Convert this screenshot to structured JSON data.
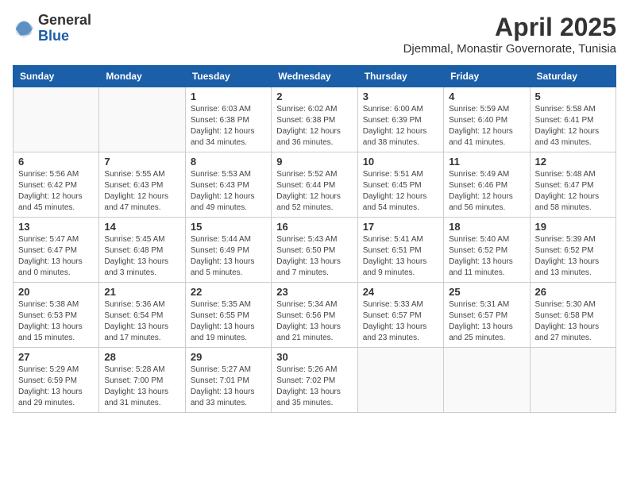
{
  "header": {
    "logo_general": "General",
    "logo_blue": "Blue",
    "month_title": "April 2025",
    "subtitle": "Djemmal, Monastir Governorate, Tunisia"
  },
  "weekdays": [
    "Sunday",
    "Monday",
    "Tuesday",
    "Wednesday",
    "Thursday",
    "Friday",
    "Saturday"
  ],
  "weeks": [
    [
      {
        "day": "",
        "info": ""
      },
      {
        "day": "",
        "info": ""
      },
      {
        "day": "1",
        "info": "Sunrise: 6:03 AM\nSunset: 6:38 PM\nDaylight: 12 hours and 34 minutes."
      },
      {
        "day": "2",
        "info": "Sunrise: 6:02 AM\nSunset: 6:38 PM\nDaylight: 12 hours and 36 minutes."
      },
      {
        "day": "3",
        "info": "Sunrise: 6:00 AM\nSunset: 6:39 PM\nDaylight: 12 hours and 38 minutes."
      },
      {
        "day": "4",
        "info": "Sunrise: 5:59 AM\nSunset: 6:40 PM\nDaylight: 12 hours and 41 minutes."
      },
      {
        "day": "5",
        "info": "Sunrise: 5:58 AM\nSunset: 6:41 PM\nDaylight: 12 hours and 43 minutes."
      }
    ],
    [
      {
        "day": "6",
        "info": "Sunrise: 5:56 AM\nSunset: 6:42 PM\nDaylight: 12 hours and 45 minutes."
      },
      {
        "day": "7",
        "info": "Sunrise: 5:55 AM\nSunset: 6:43 PM\nDaylight: 12 hours and 47 minutes."
      },
      {
        "day": "8",
        "info": "Sunrise: 5:53 AM\nSunset: 6:43 PM\nDaylight: 12 hours and 49 minutes."
      },
      {
        "day": "9",
        "info": "Sunrise: 5:52 AM\nSunset: 6:44 PM\nDaylight: 12 hours and 52 minutes."
      },
      {
        "day": "10",
        "info": "Sunrise: 5:51 AM\nSunset: 6:45 PM\nDaylight: 12 hours and 54 minutes."
      },
      {
        "day": "11",
        "info": "Sunrise: 5:49 AM\nSunset: 6:46 PM\nDaylight: 12 hours and 56 minutes."
      },
      {
        "day": "12",
        "info": "Sunrise: 5:48 AM\nSunset: 6:47 PM\nDaylight: 12 hours and 58 minutes."
      }
    ],
    [
      {
        "day": "13",
        "info": "Sunrise: 5:47 AM\nSunset: 6:47 PM\nDaylight: 13 hours and 0 minutes."
      },
      {
        "day": "14",
        "info": "Sunrise: 5:45 AM\nSunset: 6:48 PM\nDaylight: 13 hours and 3 minutes."
      },
      {
        "day": "15",
        "info": "Sunrise: 5:44 AM\nSunset: 6:49 PM\nDaylight: 13 hours and 5 minutes."
      },
      {
        "day": "16",
        "info": "Sunrise: 5:43 AM\nSunset: 6:50 PM\nDaylight: 13 hours and 7 minutes."
      },
      {
        "day": "17",
        "info": "Sunrise: 5:41 AM\nSunset: 6:51 PM\nDaylight: 13 hours and 9 minutes."
      },
      {
        "day": "18",
        "info": "Sunrise: 5:40 AM\nSunset: 6:52 PM\nDaylight: 13 hours and 11 minutes."
      },
      {
        "day": "19",
        "info": "Sunrise: 5:39 AM\nSunset: 6:52 PM\nDaylight: 13 hours and 13 minutes."
      }
    ],
    [
      {
        "day": "20",
        "info": "Sunrise: 5:38 AM\nSunset: 6:53 PM\nDaylight: 13 hours and 15 minutes."
      },
      {
        "day": "21",
        "info": "Sunrise: 5:36 AM\nSunset: 6:54 PM\nDaylight: 13 hours and 17 minutes."
      },
      {
        "day": "22",
        "info": "Sunrise: 5:35 AM\nSunset: 6:55 PM\nDaylight: 13 hours and 19 minutes."
      },
      {
        "day": "23",
        "info": "Sunrise: 5:34 AM\nSunset: 6:56 PM\nDaylight: 13 hours and 21 minutes."
      },
      {
        "day": "24",
        "info": "Sunrise: 5:33 AM\nSunset: 6:57 PM\nDaylight: 13 hours and 23 minutes."
      },
      {
        "day": "25",
        "info": "Sunrise: 5:31 AM\nSunset: 6:57 PM\nDaylight: 13 hours and 25 minutes."
      },
      {
        "day": "26",
        "info": "Sunrise: 5:30 AM\nSunset: 6:58 PM\nDaylight: 13 hours and 27 minutes."
      }
    ],
    [
      {
        "day": "27",
        "info": "Sunrise: 5:29 AM\nSunset: 6:59 PM\nDaylight: 13 hours and 29 minutes."
      },
      {
        "day": "28",
        "info": "Sunrise: 5:28 AM\nSunset: 7:00 PM\nDaylight: 13 hours and 31 minutes."
      },
      {
        "day": "29",
        "info": "Sunrise: 5:27 AM\nSunset: 7:01 PM\nDaylight: 13 hours and 33 minutes."
      },
      {
        "day": "30",
        "info": "Sunrise: 5:26 AM\nSunset: 7:02 PM\nDaylight: 13 hours and 35 minutes."
      },
      {
        "day": "",
        "info": ""
      },
      {
        "day": "",
        "info": ""
      },
      {
        "day": "",
        "info": ""
      }
    ]
  ]
}
